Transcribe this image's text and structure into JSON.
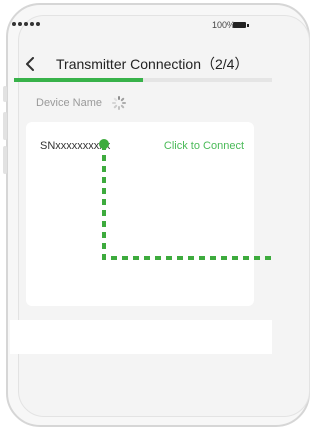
{
  "status": {
    "battery": "100%"
  },
  "nav": {
    "title": "Transmitter Connection（2/4）"
  },
  "progress": {
    "fraction": 0.5
  },
  "section": {
    "label": "Device Name"
  },
  "device": {
    "serial": "SNxxxxxxxxxx",
    "action": "Click to Connect"
  },
  "colors": {
    "accent": "#38b24a",
    "guide": "#3dab3d"
  },
  "icons": {
    "back": "chevron-left-icon",
    "loading": "spinner-icon",
    "battery": "battery-icon",
    "signal": "signal-dots-icon"
  }
}
